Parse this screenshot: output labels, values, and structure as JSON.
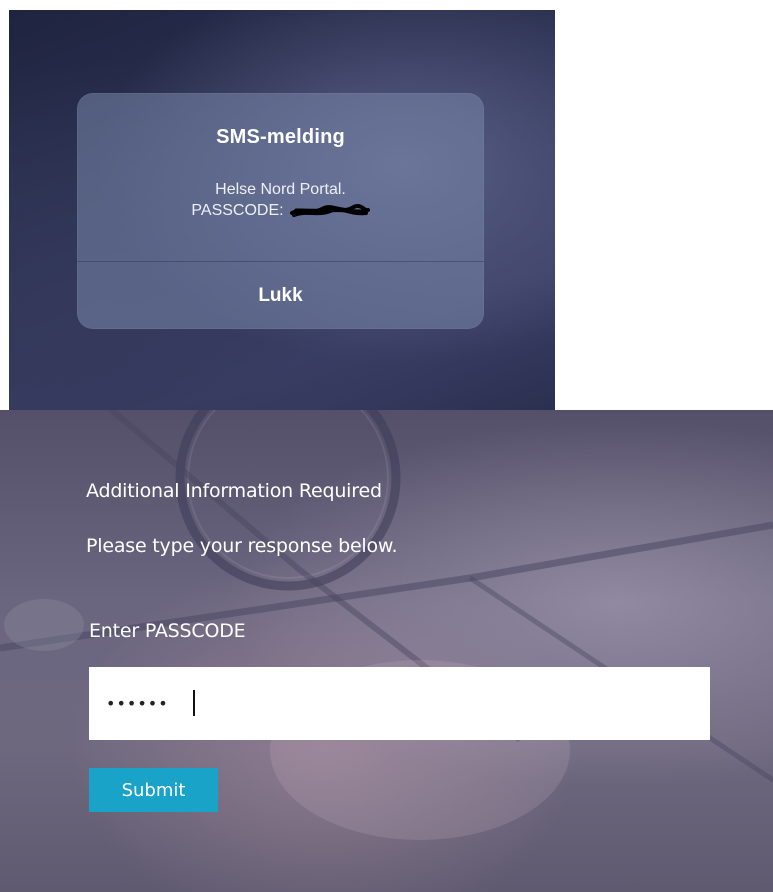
{
  "sms_alert": {
    "title": "SMS-melding",
    "body_line1": "Helse Nord Portal.",
    "passcode_label": "PASSCODE:",
    "passcode_value_redacted": true,
    "close_label": "Lukk"
  },
  "portal": {
    "heading": "Additional Information Required",
    "subtitle": "Please type your response below.",
    "passcode_field_label": "Enter PASSCODE",
    "passcode_field_value": "••••••",
    "submit_label": "Submit"
  },
  "colors": {
    "submit_button": "#1aa3c9",
    "sms_alert_background": "#7886aa",
    "portal_text": "#ffffff"
  },
  "icons": [
    "redaction-scribble"
  ]
}
